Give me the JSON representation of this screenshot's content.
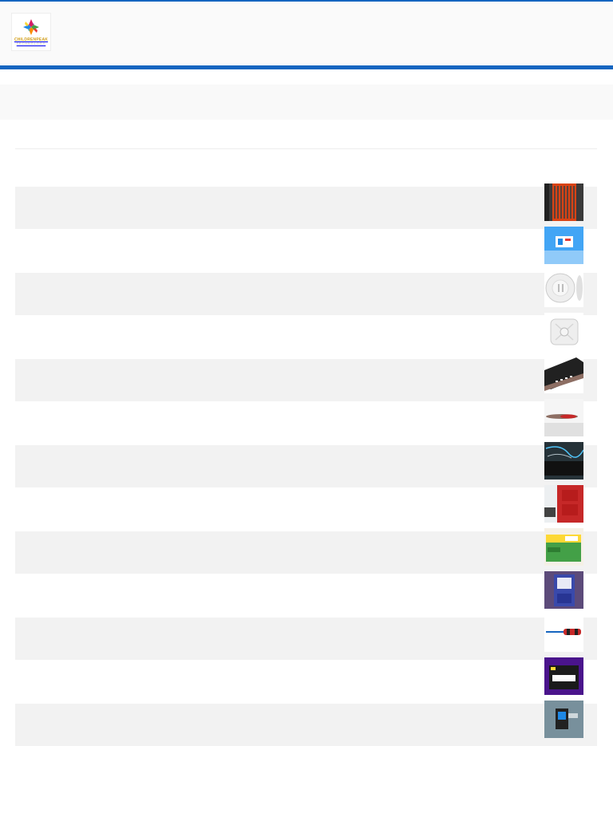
{
  "header": {
    "logo": {
      "name": "CHILDREN PEAK",
      "wordmark": "CHILDRENPEAK",
      "subtext": "TECHNOLOGY"
    }
  },
  "colors": {
    "accent": "#1565c0",
    "header_bg": "#fafafa",
    "row_alt": "#f2f2f2"
  },
  "products": [
    {
      "title": "",
      "image": "orange-cable-panel"
    },
    {
      "title": "",
      "image": "blue-device-box"
    },
    {
      "title": "",
      "image": "white-round-antenna"
    },
    {
      "title": "",
      "image": "white-square-antenna"
    },
    {
      "title": "",
      "image": "black-network-switch"
    },
    {
      "title": "",
      "image": "red-handled-tool"
    },
    {
      "title": "",
      "image": "black-router-cables"
    },
    {
      "title": "",
      "image": "red-electrical-panel"
    },
    {
      "title": "",
      "image": "green-battery-box"
    },
    {
      "title": "",
      "image": "purple-enclosure"
    },
    {
      "title": "",
      "image": "screwdriver"
    },
    {
      "title": "",
      "image": "purple-printer"
    },
    {
      "title": "",
      "image": "blue-adapter"
    }
  ]
}
